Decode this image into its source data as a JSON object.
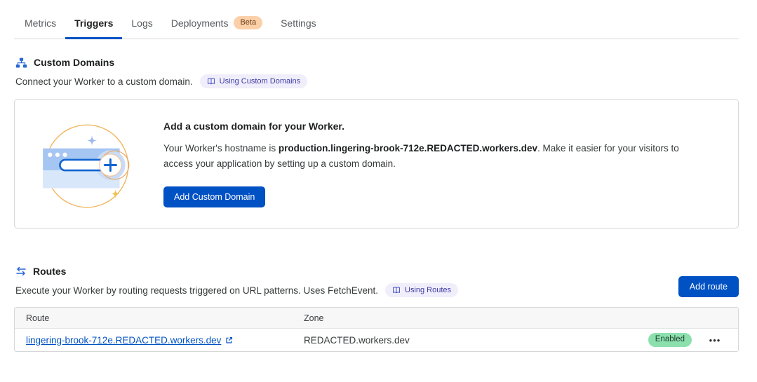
{
  "tab_bar": {
    "active_tab": "Triggers",
    "tabs": [
      {
        "label": "Metrics"
      },
      {
        "label": "Triggers"
      },
      {
        "label": "Logs"
      },
      {
        "label": "Deployments",
        "badge": "Beta"
      },
      {
        "label": "Settings"
      }
    ]
  },
  "custom_domains": {
    "icon": "sitemap-icon",
    "title": "Custom Domains",
    "description": "Connect your Worker to a custom domain.",
    "docs_link": {
      "icon": "book-icon",
      "label": "Using Custom Domains"
    },
    "card": {
      "heading": "Add a custom domain for your Worker.",
      "body_prefix": "Your Worker's hostname is ",
      "hostname": "production.lingering-brook-712e.REDACTED.workers.dev",
      "body_suffix": ". Make it easier for your visitors to access your application by setting up a custom domain.",
      "add_button": "Add Custom Domain"
    }
  },
  "routes": {
    "icon": "swap-arrows-icon",
    "title": "Routes",
    "description": "Execute your Worker by routing requests triggered on URL patterns. Uses FetchEvent.",
    "docs_link": {
      "icon": "book-icon",
      "label": "Using Routes"
    },
    "add_button": "Add route",
    "table": {
      "headers": [
        "Route",
        "Zone"
      ],
      "rows": [
        {
          "route": "lingering-brook-712e.REDACTED.workers.dev",
          "external_link_icon": "external-link-icon",
          "zone": "REDACTED.workers.dev",
          "status": "Enabled",
          "menu": "•••"
        }
      ]
    }
  },
  "colors": {
    "accent_blue": "#0051c3",
    "tab_underline": "#0051c3",
    "link_blue": "#0051c3",
    "beta_badge_bg": "#fbd0a8",
    "beta_badge_text": "#6b3e12",
    "docs_pill_bg": "#f1eefb",
    "docs_pill_text": "#3b3ba3",
    "enabled_badge_bg": "#8ce0ae",
    "enabled_badge_text": "#1e3d2b",
    "illustration_orange": "#f0a63c",
    "illustration_blue": "#a5c6f2"
  }
}
